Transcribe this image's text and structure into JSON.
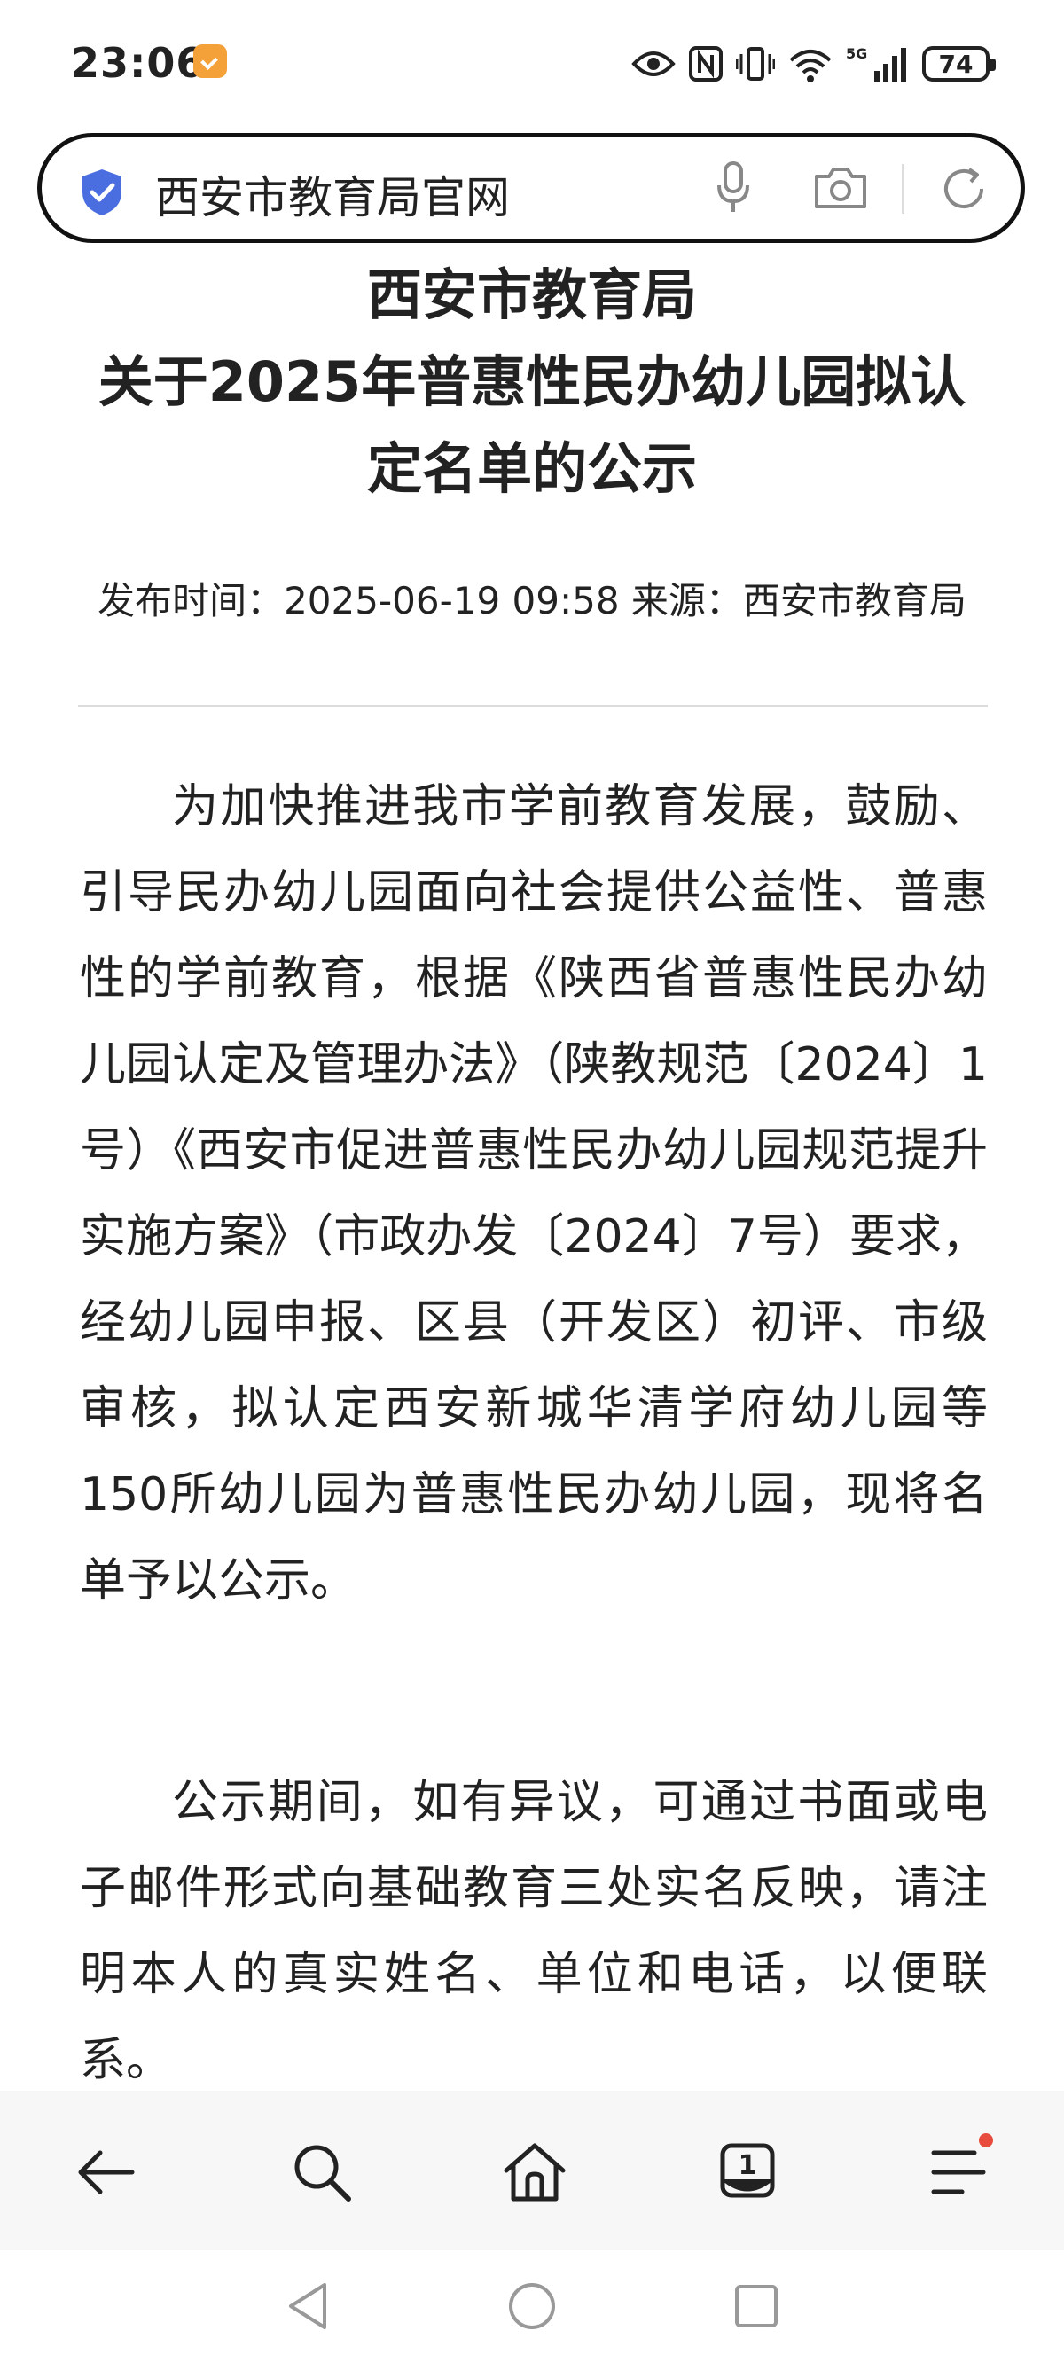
{
  "status_bar": {
    "time": "23:06",
    "battery": "74",
    "network": "5G"
  },
  "search_bar": {
    "query": "西安市教育局官网"
  },
  "article": {
    "title": "西安市教育局\n关于2025年普惠性民办幼儿园拟认\n定名单的公示",
    "meta": "发布时间：2025-06-19 09:58 来源：西安市教育局",
    "paragraph1": "为加快推进我市学前教育发展，鼓励、引导民办幼儿园面向社会提供公益性、普惠性的学前教育，根据《陕西省普惠性民办幼儿园认定及管理办法》（陕教规范〔2024〕1号）《西安市促进普惠性民办幼儿园规范提升实施方案》（市政办发〔2024〕7号）要求，经幼儿园申报、区县（开发区）初评、市级审核，拟认定西安新城华清学府幼儿园等150所幼儿园为普惠性民办幼儿园，现将名单予以公示。",
    "paragraph2": "公示期间，如有异议，可通过书面或电子邮件形式向基础教育三处实名反映，请注明本人的真实姓名、单位和电话，以便联系。"
  },
  "toolbar": {
    "tabs_count": "1",
    "menu_has_notification": true
  },
  "colors": {
    "shield": "#4a6ee0",
    "notification_dot": "#e74c3c",
    "toolbar_bg": "#f7f7f7"
  }
}
